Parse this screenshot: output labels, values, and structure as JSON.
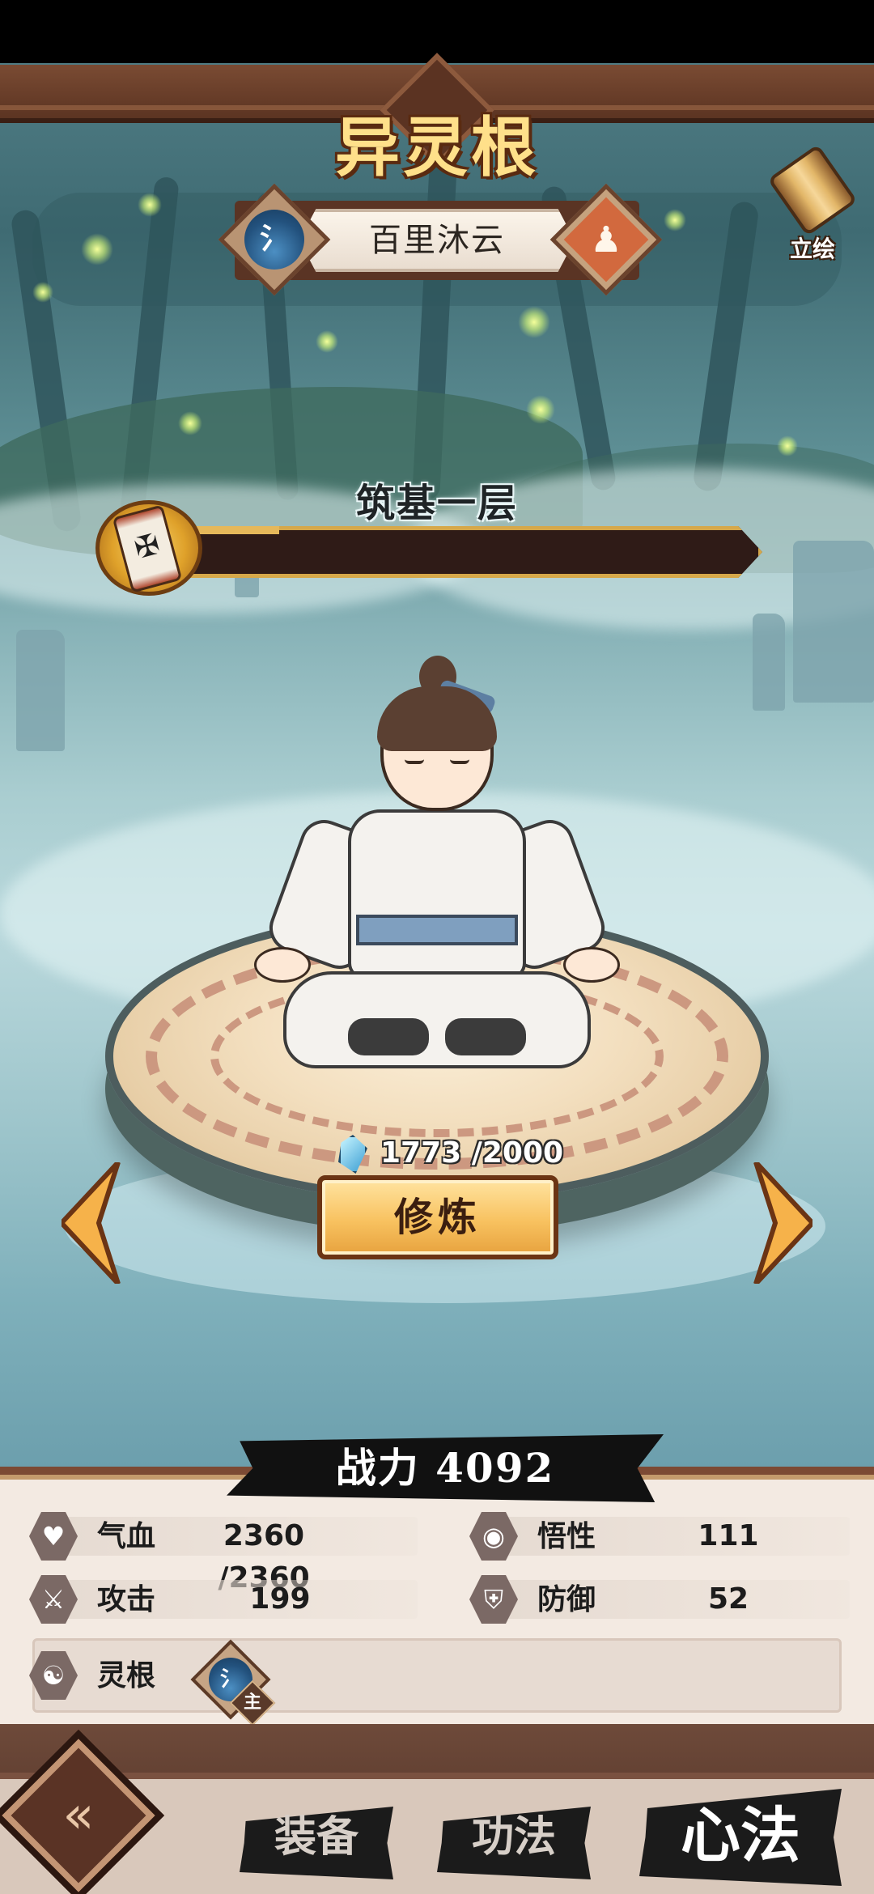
{
  "header": {
    "title": "异灵根",
    "character_name": "百里沐云",
    "element_glyph": "氵",
    "portrait_label": "立绘"
  },
  "cultivation": {
    "realm": "筑基一层",
    "progress": 0.0,
    "exp_text": "1773 /2000",
    "cultivate_label": "修炼"
  },
  "power": {
    "text": "战力 4092"
  },
  "stats": {
    "hp_label": "气血",
    "hp_value": "2360 /2360",
    "attack_label": "攻击",
    "attack_value": "199",
    "insight_label": "悟性",
    "insight_value": "111",
    "defense_label": "防御",
    "defense_value": "52"
  },
  "spirit_root": {
    "label": "灵根",
    "badge_glyph": "氵",
    "main_tag": "主"
  },
  "tabs": [
    {
      "label": "装备",
      "active": false
    },
    {
      "label": "功法",
      "active": false
    },
    {
      "label": "心法",
      "active": true
    }
  ],
  "icons": {
    "hp": "heart-icon",
    "attack": "sword-icon",
    "insight": "eye-icon",
    "defense": "shield-icon",
    "root": "yin-yang-icon"
  },
  "colors": {
    "frame": "#7a4b33",
    "accent_gold": "#f8c260",
    "title_gold": "#ffe08a"
  }
}
